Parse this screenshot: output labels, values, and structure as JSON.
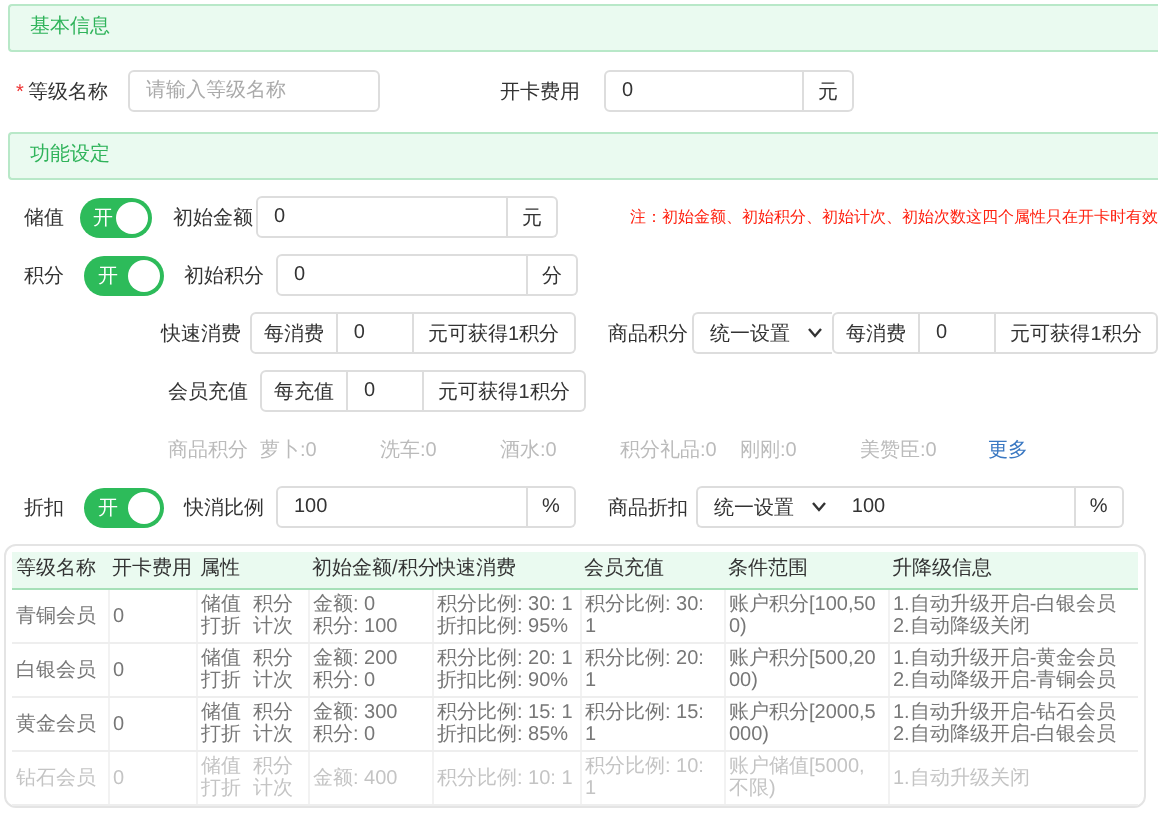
{
  "basic_section": {
    "title": "基本信息"
  },
  "basic_fields": {
    "level_name": {
      "required_mark": "*",
      "label": "等级名称",
      "placeholder": "请输入等级名称"
    },
    "card_fee": {
      "label": "开卡费用",
      "value": "0",
      "unit": "元"
    }
  },
  "function_section": {
    "title": "功能设定"
  },
  "stored_value": {
    "label": "储值",
    "switch": {
      "on": true,
      "text": "开"
    },
    "field": {
      "label": "初始金额",
      "value": "0",
      "unit": "元"
    },
    "note": "注：初始金额、初始积分、初始计次、初始次数这四个属性只在开卡时有效"
  },
  "points": {
    "label": "积分",
    "switch": {
      "on": true,
      "text": "开"
    },
    "field": {
      "label": "初始积分",
      "value": "0",
      "unit": "分"
    }
  },
  "quick_consume": {
    "label": "快速消费",
    "prefix": "每消费",
    "value": "0",
    "suffix": "元可获得1积分"
  },
  "goods_points": {
    "label": "商品积分",
    "select": "统一设置",
    "prefix": "每消费",
    "value": "0",
    "suffix": "元可获得1积分"
  },
  "member_recharge": {
    "label": "会员充值",
    "prefix": "每充值",
    "value": "0",
    "suffix": "元可获得1积分"
  },
  "goods_points_list": {
    "label": "商品积分",
    "items": [
      "萝卜:0",
      "洗车:0",
      "酒水:0",
      "积分礼品:0",
      "刚刚:0",
      "美赞臣:0"
    ],
    "more": "更多"
  },
  "discount": {
    "label": "折扣",
    "switch": {
      "on": true,
      "text": "开"
    },
    "field": {
      "label": "快消比例",
      "value": "100",
      "unit": "%"
    },
    "goods": {
      "label": "商品折扣",
      "select": "统一设置",
      "value": "100",
      "unit": "%"
    }
  },
  "table": {
    "columns": [
      "等级名称",
      "开卡费用",
      "属性",
      "初始金额/积分",
      "快速消费",
      "会员充值",
      "条件范围",
      "升降级信息"
    ],
    "rows": [
      {
        "cells": [
          [
            "青铜会员"
          ],
          [
            "0"
          ],
          [
            "储值",
            "积分",
            "打折",
            "计次"
          ],
          [
            "金额: 0",
            "积分: 100"
          ],
          [
            "积分比例: 30: 1",
            "折扣比例: 95%"
          ],
          [
            "积分比例: 30: 1"
          ],
          [
            "账户积分[100,500)"
          ],
          [
            "1.自动升级开启-白银会员",
            "2.自动降级关闭"
          ]
        ]
      },
      {
        "cells": [
          [
            "白银会员"
          ],
          [
            "0"
          ],
          [
            "储值",
            "积分",
            "打折",
            "计次"
          ],
          [
            "金额: 200",
            "积分: 0"
          ],
          [
            "积分比例: 20: 1",
            "折扣比例: 90%"
          ],
          [
            "积分比例: 20: 1"
          ],
          [
            "账户积分[500,2000)"
          ],
          [
            "1.自动升级开启-黄金会员",
            "2.自动降级开启-青铜会员"
          ]
        ]
      },
      {
        "cells": [
          [
            "黄金会员"
          ],
          [
            "0"
          ],
          [
            "储值",
            "积分",
            "打折",
            "计次"
          ],
          [
            "金额: 300",
            "积分: 0"
          ],
          [
            "积分比例: 15: 1",
            "折扣比例: 85%"
          ],
          [
            "积分比例: 15: 1"
          ],
          [
            "账户积分[2000,5000)"
          ],
          [
            "1.自动升级开启-钻石会员",
            "2.自动降级开启-白银会员"
          ]
        ]
      },
      {
        "cells": [
          [
            "钻石会员"
          ],
          [
            "0"
          ],
          [
            "储值",
            "积分",
            "打折",
            "计次"
          ],
          [
            "金额: 400"
          ],
          [
            "积分比例: 10: 1"
          ],
          [
            "积分比例: 10: 1"
          ],
          [
            "账户储值[5000,不限)"
          ],
          [
            "1.自动升级关闭"
          ]
        ]
      }
    ]
  }
}
